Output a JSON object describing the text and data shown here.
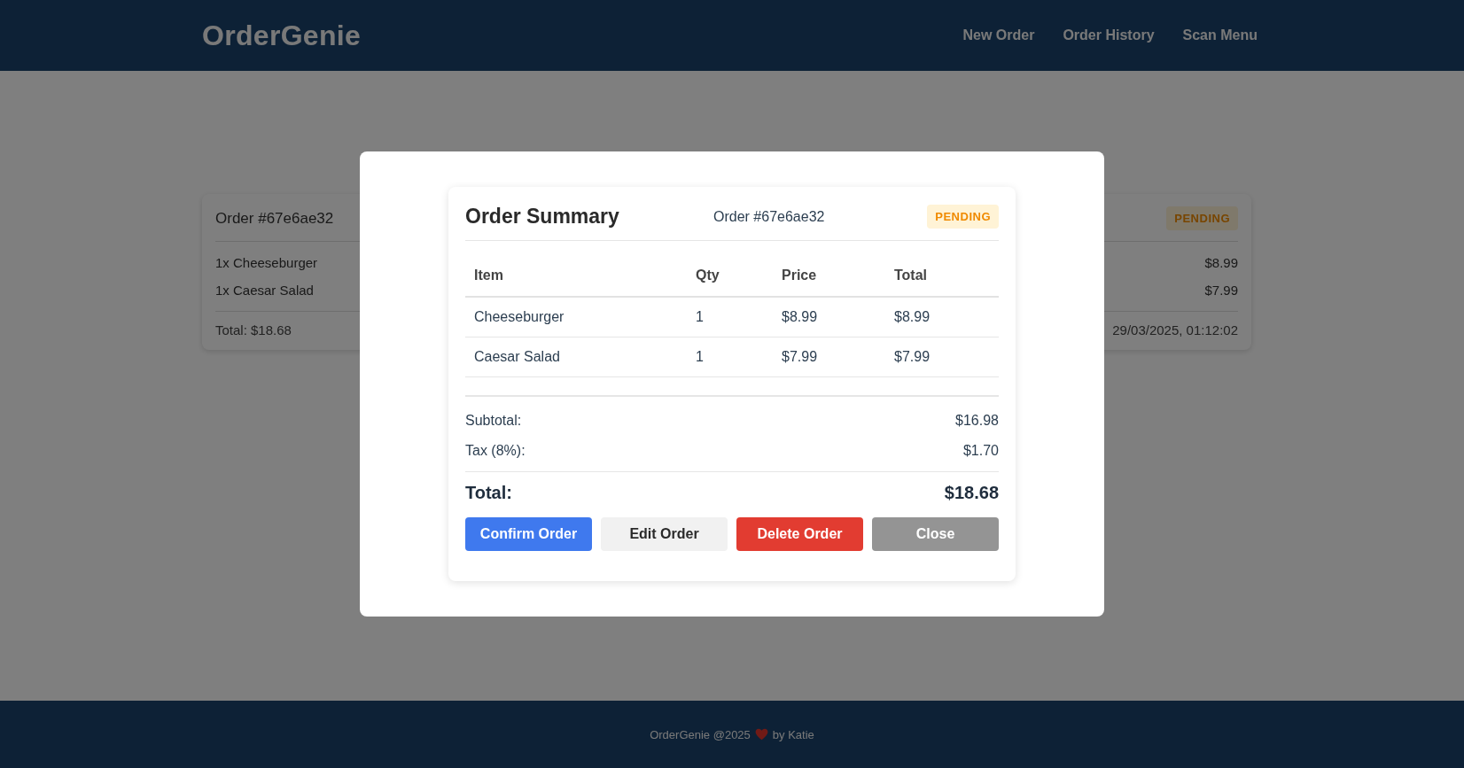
{
  "header": {
    "logo": "OrderGenie",
    "nav": [
      "New Order",
      "Order History",
      "Scan Menu"
    ]
  },
  "page": {
    "orders": [
      {
        "order_id": "Order #67e6ae32",
        "status": "PENDING",
        "items": [
          {
            "name": "1x Cheeseburger",
            "price": "$8.99"
          },
          {
            "name": "1x Caesar Salad",
            "price": "$7.99"
          }
        ],
        "total": "Total: $18.68",
        "date": "29/03/2025, 01:12:02"
      }
    ]
  },
  "modal": {
    "title": "Order Summary",
    "order_id": "Order #67e6ae32",
    "status": "PENDING",
    "columns": [
      "Item",
      "Qty",
      "Price",
      "Total"
    ],
    "rows": [
      [
        "Cheeseburger",
        "1",
        "$8.99",
        "$8.99"
      ],
      [
        "Caesar Salad",
        "1",
        "$7.99",
        "$7.99"
      ]
    ],
    "summary": [
      {
        "label": "Subtotal:",
        "value": "$16.98"
      },
      {
        "label": "Tax (8%):",
        "value": "$1.70"
      }
    ],
    "total": {
      "label": "Total:",
      "value": "$18.68"
    },
    "buttons": [
      {
        "label": "Confirm Order",
        "kind": "primary"
      },
      {
        "label": "Edit Order",
        "kind": "secondary"
      },
      {
        "label": "Delete Order",
        "kind": "danger"
      },
      {
        "label": "Close",
        "kind": "neutral"
      }
    ]
  },
  "footer": {
    "before": "OrderGenie @2025",
    "after": "by Katie"
  }
}
